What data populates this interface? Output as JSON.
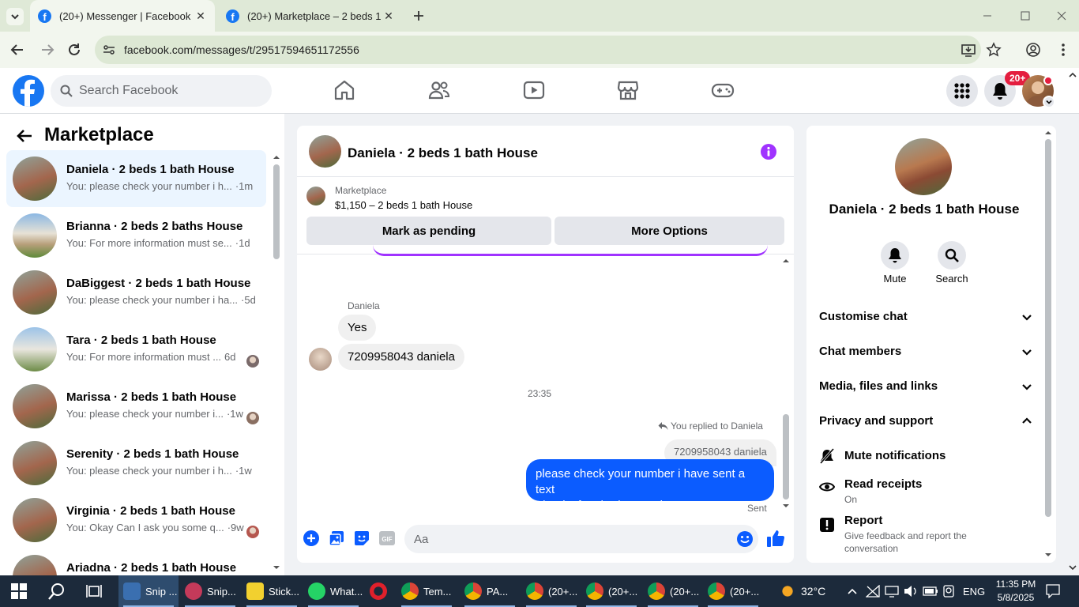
{
  "browser": {
    "tabs": [
      {
        "title": "(20+) Messenger | Facebook",
        "active": true
      },
      {
        "title": "(20+) Marketplace – 2 beds 1 b",
        "active": false
      }
    ],
    "url": "facebook.com/messages/t/29517594651172556"
  },
  "fb_header": {
    "search_placeholder": "Search Facebook",
    "notification_badge": "20+"
  },
  "left_panel": {
    "title": "Marketplace",
    "conversations": [
      {
        "name": "Daniela · 2 beds 1 bath House",
        "preview": "You: please check your number i h...",
        "time": "·1m",
        "selected": true
      },
      {
        "name": "Brianna · 2 beds 2 baths House",
        "preview": "You: For more information must se...",
        "time": "·1d"
      },
      {
        "name": "DaBiggest · 2 beds 1 bath House",
        "preview": "You: please check your number i ha...",
        "time": "·5d"
      },
      {
        "name": "Tara · 2 beds 1 bath House",
        "preview": "You: For more information must ...",
        "time": "6d"
      },
      {
        "name": "Marissa · 2 beds 1 bath House",
        "preview": "You: please check your number i...",
        "time": "·1w"
      },
      {
        "name": "Serenity · 2 beds 1 bath House",
        "preview": "You: please check your number i h...",
        "time": "·1w"
      },
      {
        "name": "Virginia · 2 beds 1 bath House",
        "preview": "You: Okay Can I ask you some q...",
        "time": "·9w"
      },
      {
        "name": "Ariadna · 2 beds 1 bath House",
        "preview": "",
        "time": ""
      }
    ]
  },
  "chat": {
    "header_title": "Daniela · 2 beds 1 bath House",
    "listing_source": "Marketplace",
    "listing_info": "$1,150 – 2 beds 1 bath House",
    "mark_pending_label": "Mark as pending",
    "more_options_label": "More Options",
    "sender_label": "Daniela",
    "incoming_messages": [
      "Yes",
      "7209958043 daniela"
    ],
    "timestamp": "23:35",
    "reply_note": "You replied to Daniela",
    "quoted_text": "7209958043 daniela",
    "outgoing_lines": [
      "please check your number i have sent a text",
      "Thanks for sharing number"
    ],
    "sent_status": "Sent",
    "composer_placeholder": "Aa"
  },
  "right_panel": {
    "title": "Daniela · 2 beds 1 bath House",
    "mute_label": "Mute",
    "search_label": "Search",
    "sections": [
      "Customise chat",
      "Chat members",
      "Media, files and links",
      "Privacy and support"
    ],
    "mute_notifications": "Mute notifications",
    "read_receipts": "Read receipts",
    "read_receipts_value": "On",
    "report": "Report",
    "report_desc_1": "Give feedback and report the",
    "report_desc_2": "conversation"
  },
  "taskbar": {
    "apps": [
      "Snip ...",
      "Snip...",
      "Stick...",
      "What...",
      "Tem...",
      "PA...",
      "(20+...",
      "(20+...",
      "(20+...",
      "(20+..."
    ],
    "weather": "32°C",
    "language": "ENG",
    "time": "11:35 PM",
    "date": "5/8/2025"
  },
  "colors": {
    "fb_blue": "#1877f2",
    "messenger_blue": "#0b5cff",
    "accent_purple": "#a033ff",
    "browser_frame": "#dfe9d7",
    "taskbar": "#1c2a3b"
  }
}
